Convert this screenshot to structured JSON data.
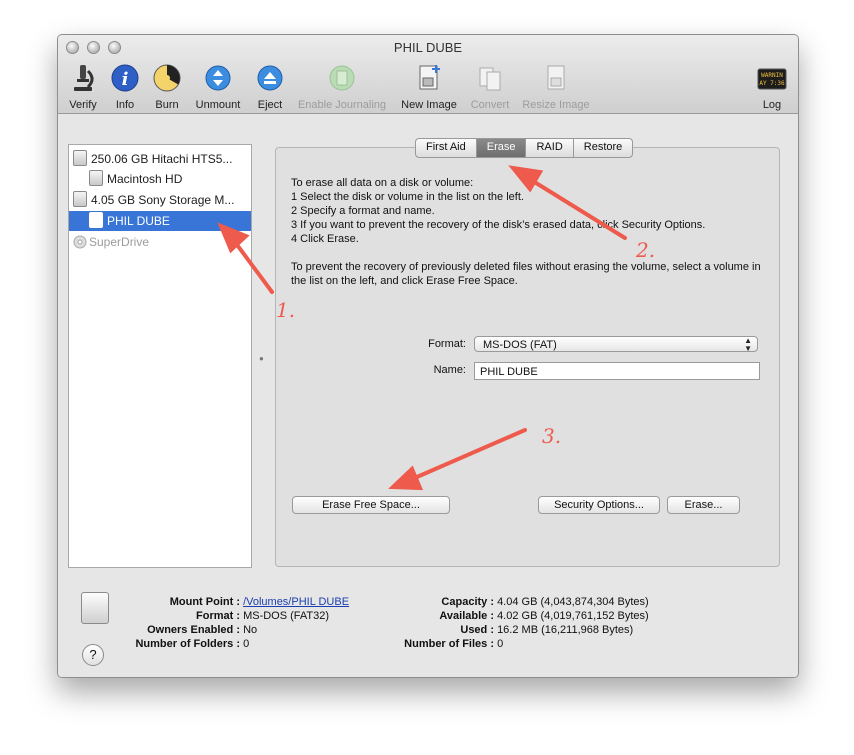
{
  "window": {
    "title": "PHIL DUBE"
  },
  "toolbar": {
    "items": [
      {
        "label": "Verify",
        "icon": "microscope-icon"
      },
      {
        "label": "Info",
        "icon": "info-icon"
      },
      {
        "label": "Burn",
        "icon": "burn-icon"
      },
      {
        "label": "Unmount",
        "icon": "unmount-icon"
      },
      {
        "label": "Eject",
        "icon": "eject-icon"
      },
      {
        "label": "Enable Journaling",
        "icon": "journal-icon"
      },
      {
        "label": "New Image",
        "icon": "new-image-icon"
      },
      {
        "label": "Convert",
        "icon": "convert-icon"
      },
      {
        "label": "Resize Image",
        "icon": "resize-image-icon"
      },
      {
        "label": "Log",
        "icon": "log-icon"
      }
    ],
    "log_icon_text": "WARNIN\nAY 7:36"
  },
  "sidebar": {
    "items": [
      {
        "label": "250.06 GB Hitachi HTS5..."
      },
      {
        "label": "Macintosh HD"
      },
      {
        "label": "4.05 GB Sony Storage M..."
      },
      {
        "label": "PHIL DUBE"
      },
      {
        "label": "SuperDrive"
      }
    ]
  },
  "tabs": [
    "First Aid",
    "Erase",
    "RAID",
    "Restore"
  ],
  "erase": {
    "instructions": [
      "To erase all data on a disk or volume:",
      "1 Select the disk or volume in the list on the left.",
      "2 Specify a format and name.",
      "3 If you want to prevent the recovery of the disk’s erased data, click Security Options.",
      "4 Click Erase."
    ],
    "free_space_note": "To prevent the recovery of previously deleted files without erasing the volume, select a volume in the list on the left, and click Erase Free Space.",
    "format_label": "Format:",
    "format_value": "MS-DOS (FAT)",
    "name_label": "Name:",
    "name_value": "PHIL DUBE",
    "erase_free_space_button": "Erase Free Space...",
    "security_options_button": "Security Options...",
    "erase_button": "Erase..."
  },
  "info": {
    "mount_point_label": "Mount Point :",
    "mount_point": "/Volumes/PHIL DUBE",
    "format_label": "Format :",
    "format": "MS-DOS (FAT32)",
    "owners_label": "Owners Enabled :",
    "owners": "No",
    "folders_label": "Number of Folders :",
    "folders": "0",
    "capacity_label": "Capacity :",
    "capacity": "4.04 GB (4,043,874,304 Bytes)",
    "available_label": "Available :",
    "available": "4.02 GB (4,019,761,152 Bytes)",
    "used_label": "Used :",
    "used": "16.2 MB (16,211,968 Bytes)",
    "files_label": "Number of Files :",
    "files": "0",
    "help": "?"
  },
  "annotations": [
    "1.",
    "2.",
    "3."
  ],
  "colors": {
    "selection": "#3875d7",
    "annotation": "#ee5a4c"
  }
}
